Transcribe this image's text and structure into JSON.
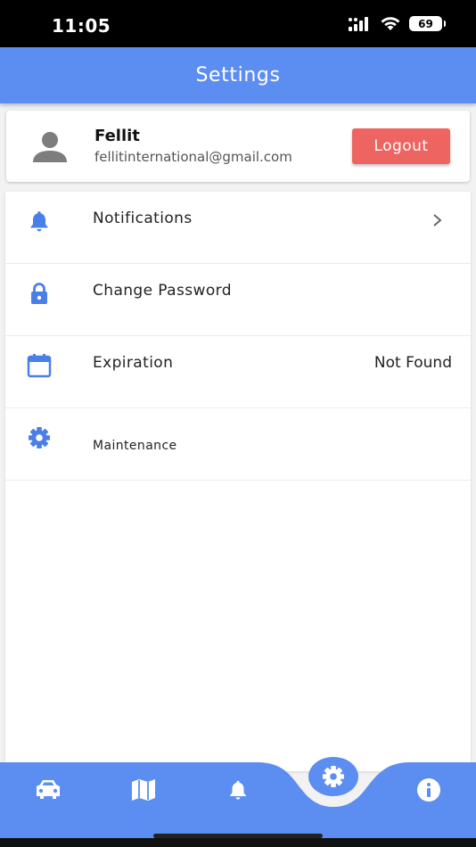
{
  "status_bar": {
    "time": "11:05",
    "battery": "69"
  },
  "header": {
    "title": "Settings"
  },
  "profile": {
    "name": "Fellit",
    "email": "fellitinternational@gmail.com",
    "logout_label": "Logout"
  },
  "settings": {
    "items": [
      {
        "label": "Notifications",
        "icon": "bell-icon",
        "has_chevron": true
      },
      {
        "label": "Change Password",
        "icon": "lock-icon"
      },
      {
        "label": "Expiration",
        "icon": "calendar-icon",
        "value": "Not Found"
      },
      {
        "label": "Maintenance",
        "icon": "gear-icon"
      }
    ]
  },
  "bottom_nav": {
    "items": [
      {
        "icon": "car-icon"
      },
      {
        "icon": "map-icon"
      },
      {
        "icon": "bell-icon"
      },
      {
        "icon": "gear-icon",
        "active": true
      },
      {
        "icon": "info-icon"
      }
    ]
  },
  "colors": {
    "primary": "#5b8ef0",
    "logout": "#ee6461",
    "icon_blue": "#4a7fe8",
    "avatar_gray": "#7d7d7d"
  }
}
